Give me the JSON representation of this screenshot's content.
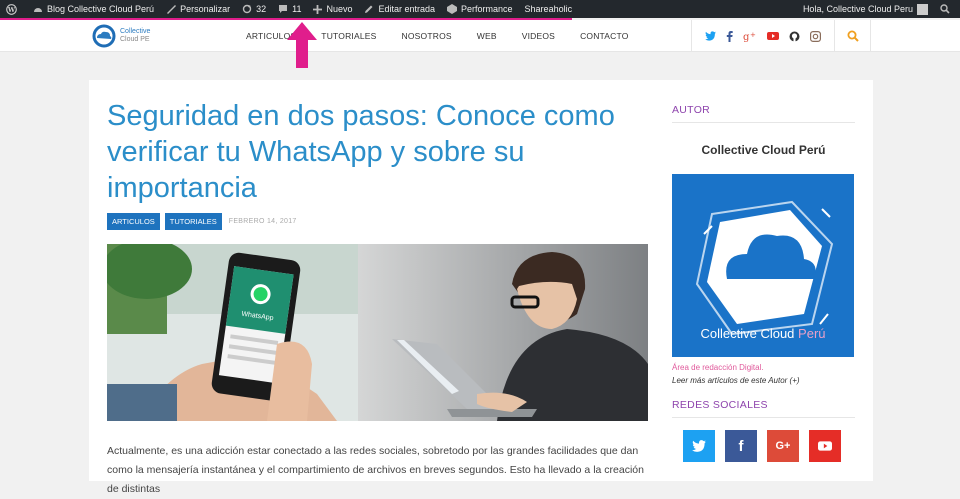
{
  "adminbar": {
    "site": "Blog Collective Cloud Perú",
    "customize": "Personalizar",
    "updates": "32",
    "comments": "11",
    "new": "Nuevo",
    "edit": "Editar entrada",
    "performance": "Performance",
    "shareaholic": "Shareaholic",
    "greeting": "Hola, Collective Cloud Peru"
  },
  "header": {
    "logo_line1": "Collective",
    "logo_line2": "Cloud PE",
    "nav": [
      "ARTICULOS",
      "TUTORIALES",
      "NOSOTROS",
      "WEB",
      "VIDEOS",
      "CONTACTO"
    ]
  },
  "post": {
    "title": "Seguridad en dos pasos: Conoce como verificar tu WhatsApp y sobre su importancia",
    "tags": [
      "ARTICULOS",
      "TUTORIALES"
    ],
    "date": "FEBRERO 14, 2017",
    "phone_app_label": "WhatsApp",
    "body": "Actualmente, es una adicción estar conectado a las redes sociales, sobretodo por las grandes facilidades que dan como la mensajería instantánea y el compartimiento de archivos en breves segundos. Esto ha llevado a la creación de distintas"
  },
  "sidebar": {
    "author_title": "AUTOR",
    "author_name": "Collective Cloud Perú",
    "author_image_text_1": "Collective Cloud",
    "author_image_text_2": "Perú",
    "author_role": "Área de redacción Digital.",
    "author_more": "Leer más artículos de este Autor (+)",
    "social_title": "REDES SOCIALES",
    "social_buttons": [
      {
        "name": "twitter",
        "color": "#1da1f2",
        "label": ""
      },
      {
        "name": "facebook",
        "color": "#3b5998",
        "label": "f"
      },
      {
        "name": "google-plus",
        "color": "#dd4b39",
        "label": "G+"
      },
      {
        "name": "youtube",
        "color": "#e52d27",
        "label": ""
      }
    ]
  },
  "colors": {
    "accent_pink": "#e01e8c",
    "title_blue": "#2b8ec9",
    "tag_blue": "#1e73be",
    "widget_purple": "#8e44ad"
  }
}
